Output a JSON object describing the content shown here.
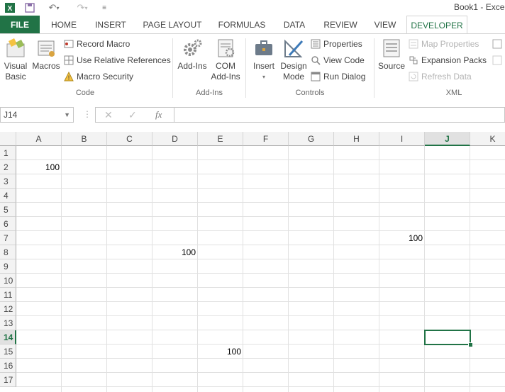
{
  "window": {
    "title": "Book1 - Exce"
  },
  "tabs": [
    "FILE",
    "HOME",
    "INSERT",
    "PAGE LAYOUT",
    "FORMULAS",
    "DATA",
    "REVIEW",
    "VIEW",
    "DEVELOPER"
  ],
  "active_tab": "DEVELOPER",
  "ribbon": {
    "code": {
      "label": "Code",
      "visual_basic": "Visual\nBasic",
      "macros": "Macros",
      "record_macro": "Record Macro",
      "relative_refs": "Use Relative References",
      "macro_security": "Macro Security"
    },
    "addins": {
      "label": "Add-Ins",
      "addins": "Add-Ins",
      "com_addins": "COM\nAdd-Ins"
    },
    "controls": {
      "label": "Controls",
      "insert": "Insert",
      "design_mode": "Design\nMode",
      "properties": "Properties",
      "view_code": "View Code",
      "run_dialog": "Run Dialog"
    },
    "xml": {
      "label": "XML",
      "source": "Source",
      "map_properties": "Map Properties",
      "expansion_packs": "Expansion Packs",
      "refresh_data": "Refresh Data"
    }
  },
  "formula_bar": {
    "name_box": "J14",
    "fx": "fx",
    "value": ""
  },
  "columns": [
    "A",
    "B",
    "C",
    "D",
    "E",
    "F",
    "G",
    "H",
    "I",
    "J",
    "K"
  ],
  "rows": [
    "1",
    "2",
    "3",
    "4",
    "5",
    "6",
    "7",
    "8",
    "9",
    "10",
    "11",
    "12",
    "13",
    "14",
    "15",
    "16",
    "17"
  ],
  "selected": {
    "column": "J",
    "row": "14"
  },
  "cells": [
    {
      "ref": "A2",
      "value": "100"
    },
    {
      "ref": "I7",
      "value": "100"
    },
    {
      "ref": "D8",
      "value": "100"
    },
    {
      "ref": "E15",
      "value": "100"
    }
  ],
  "colors": {
    "accent": "#217346",
    "grid": "#d4d4d4",
    "header_bg": "#f3f3f3"
  }
}
